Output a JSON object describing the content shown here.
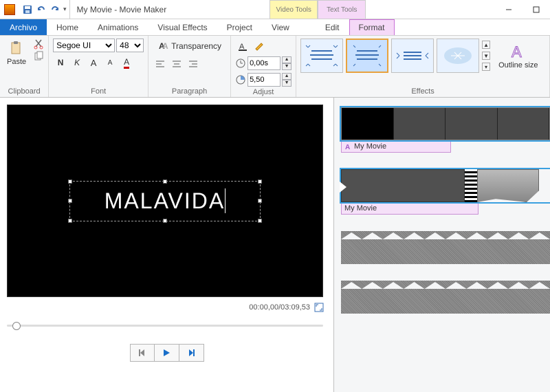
{
  "title": "My Movie - Movie Maker",
  "tooltabs": {
    "video": "Video Tools",
    "video_sub": "Edit",
    "text": "Text Tools",
    "text_sub": "Format"
  },
  "tabs": {
    "file": "Archivo",
    "home": "Home",
    "anim": "Animations",
    "vfx": "Visual Effects",
    "project": "Project",
    "view": "View",
    "edit": "Edit",
    "format": "Format"
  },
  "groups": {
    "clipboard": "Clipboard",
    "font": "Font",
    "paragraph": "Paragraph",
    "adjust": "Adjust",
    "effects": "Effects"
  },
  "paste": "Paste",
  "transparency": "Transparency",
  "outline": "Outline size",
  "font": {
    "name": "Segoe UI",
    "size": "48"
  },
  "adjust": {
    "start": "0,00s",
    "duration": "5,50"
  },
  "caption_text": "MALAVIDA",
  "timecode": "00:00,00/03:09,53",
  "track_label": "My Movie"
}
